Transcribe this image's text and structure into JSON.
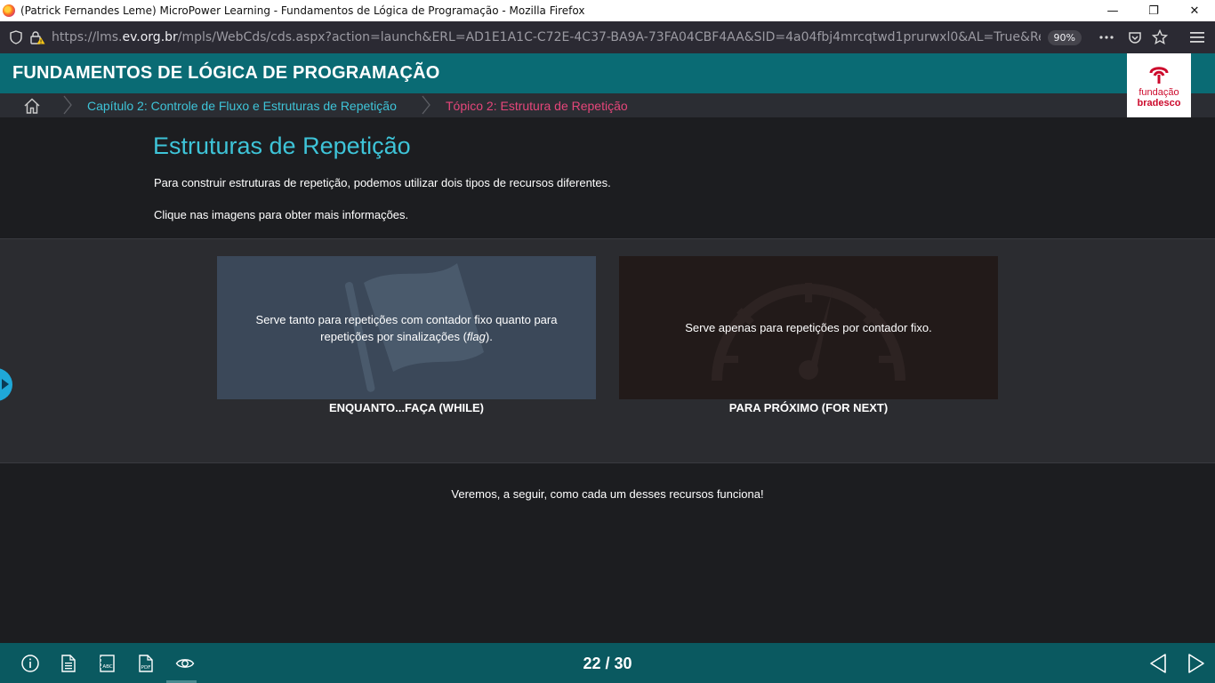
{
  "window": {
    "title": "(Patrick Fernandes Leme) MicroPower Learning - Fundamentos de Lógica de Programação - Mozilla Firefox",
    "controls": {
      "minimize": "—",
      "restore": "❐",
      "close": "✕"
    }
  },
  "browser": {
    "url_prefix": "https://lms.",
    "url_domain": "ev.org.br",
    "url_rest": "/mpls/WebCds/cds.aspx?action=launch&ERL=AD1E1A1C-C72E-4C37-BA9A-73FA04CBF4AA&SID=4a04fbj4mrcqtwd1prurwxl0&AL=True&ResumeMode=CP&D",
    "zoom": "90%",
    "icons": [
      "shield-icon",
      "lock-warning-icon",
      "more-icon",
      "pocket-icon",
      "bookmark-star-icon",
      "menu-icon"
    ]
  },
  "course": {
    "title": "FUNDAMENTOS DE LÓGICA DE PROGRAMAÇÃO",
    "logo": {
      "line1": "fundação",
      "line2": "bradesco",
      "color": "#cc0a2c"
    }
  },
  "breadcrumb": {
    "chapter": "Capítulo 2: Controle de Fluxo e Estruturas de Repetição",
    "topic": "Tópico 2: Estrutura de Repetição"
  },
  "content": {
    "heading": "Estruturas de Repetição",
    "paragraph1": "Para construir estruturas de repetição, podemos utilizar dois tipos de recursos diferentes.",
    "paragraph2": "Clique nas imagens para obter mais informações.",
    "cards": [
      {
        "text_before": "Serve tanto para repetições com contador fixo quanto para repetições por sinalizações (",
        "text_italic": "flag",
        "text_after": ").",
        "label": "ENQUANTO...FAÇA (WHILE)",
        "icon": "flag-icon"
      },
      {
        "text": "Serve apenas para repetições por contador fixo.",
        "label": "PARA PRÓXIMO (FOR NEXT)",
        "icon": "speedometer-icon"
      }
    ],
    "outro": "Veremos, a seguir, como cada um desses recursos funciona!"
  },
  "footer": {
    "page_current": "22",
    "page_total": "30",
    "page_separator": " / ",
    "icons": [
      "info-icon",
      "document-icon",
      "glossary-abc-icon",
      "pdf-icon",
      "eye-icon"
    ]
  },
  "colors": {
    "header": "#0a6b74",
    "footer": "#0a5960",
    "accent_cyan": "#3ec4d8",
    "accent_pink": "#e5467a"
  }
}
